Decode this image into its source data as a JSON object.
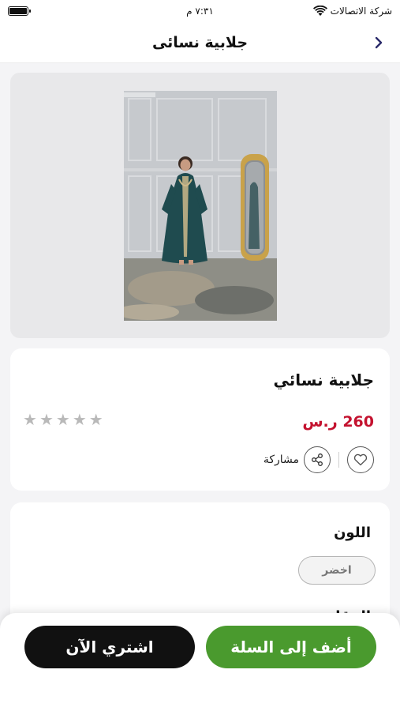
{
  "status_bar": {
    "carrier": "شركة الاتصالات",
    "time": "٧:٣١ م"
  },
  "nav": {
    "title": "جلابية نسائى"
  },
  "product": {
    "name": "جلابية نسائي",
    "price": "260 ر.س",
    "rating_stars": 5,
    "rating_value": 0,
    "share_label": "مشاركة"
  },
  "color_section": {
    "title": "اللون",
    "selected_option": "اخضر",
    "next_section_title": "المقاس"
  },
  "actions": {
    "add_to_cart": "أضف إلى السلة",
    "buy_now": "اشتري الآن"
  },
  "colors": {
    "accent_green": "#4a9a2e",
    "price_red": "#c4122f",
    "buy_black": "#111111",
    "dress_teal": "#1f4b4f"
  },
  "icons": {
    "back": "chevron-right-icon",
    "favorite": "heart-icon",
    "share": "share-icon",
    "wifi": "wifi-icon",
    "battery": "battery-icon"
  }
}
